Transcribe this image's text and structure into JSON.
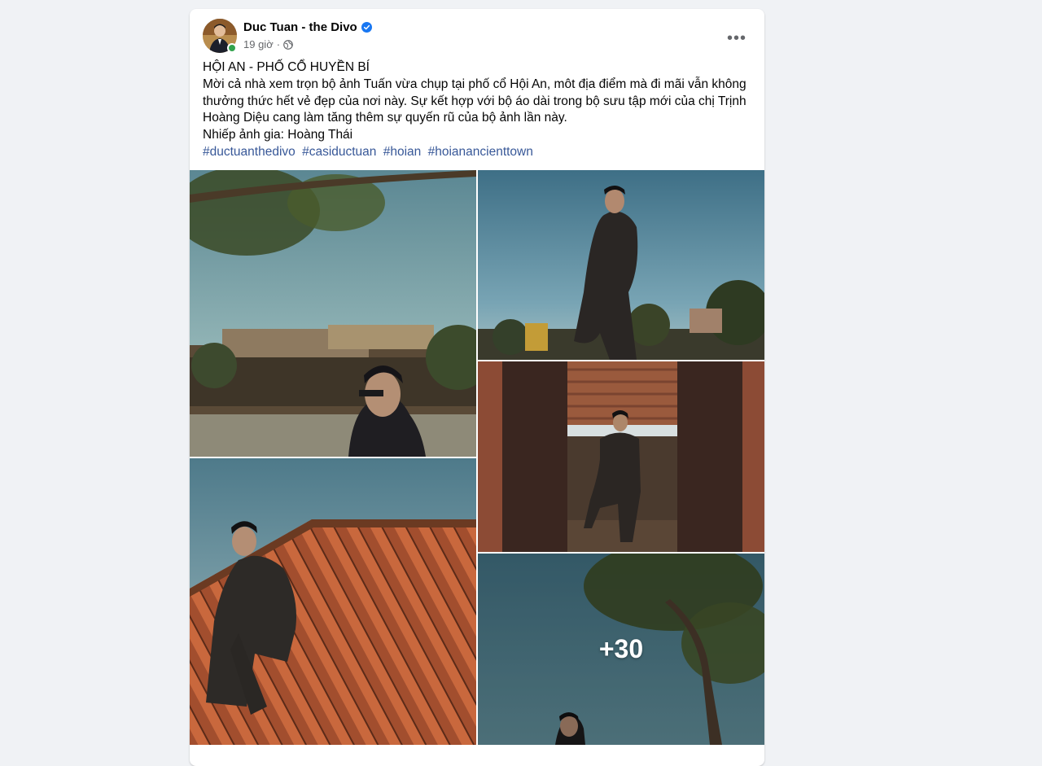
{
  "post": {
    "author": "Duc Tuan - the Divo",
    "time": "19 giờ",
    "separator": "·",
    "more_label": "•••",
    "title_line": "HỘI AN - PHỐ CỔ HUYỀN BÍ",
    "body_lines": [
      "Mời cả nhà xem trọn bộ ảnh Tuấn vừa chụp tại phố cổ Hội An, môt địa điểm mà đi mãi vẫn không thưởng thức hết vẻ đẹp của nơi này. Sự kết hợp với bộ áo dài trong bộ sưu tập mới của chị Trịnh Hoàng Diệu cang làm tăng thêm sự quyến rũ của bộ ảnh lần này.",
      "Nhiếp ảnh gia: Hoàng Thái"
    ],
    "hashtags": [
      "#ductuanthedivo",
      "#casiductuan",
      "#hoian",
      "#hoianancienttown"
    ],
    "more_photos_label": "+30"
  },
  "colors": {
    "hashtag": "#385898",
    "verified": "#1877f2",
    "online": "#31a24c",
    "meta": "#65676b"
  },
  "icons": {
    "verified": "verified-badge-icon",
    "privacy": "globe-icon",
    "more": "more-options-icon"
  }
}
